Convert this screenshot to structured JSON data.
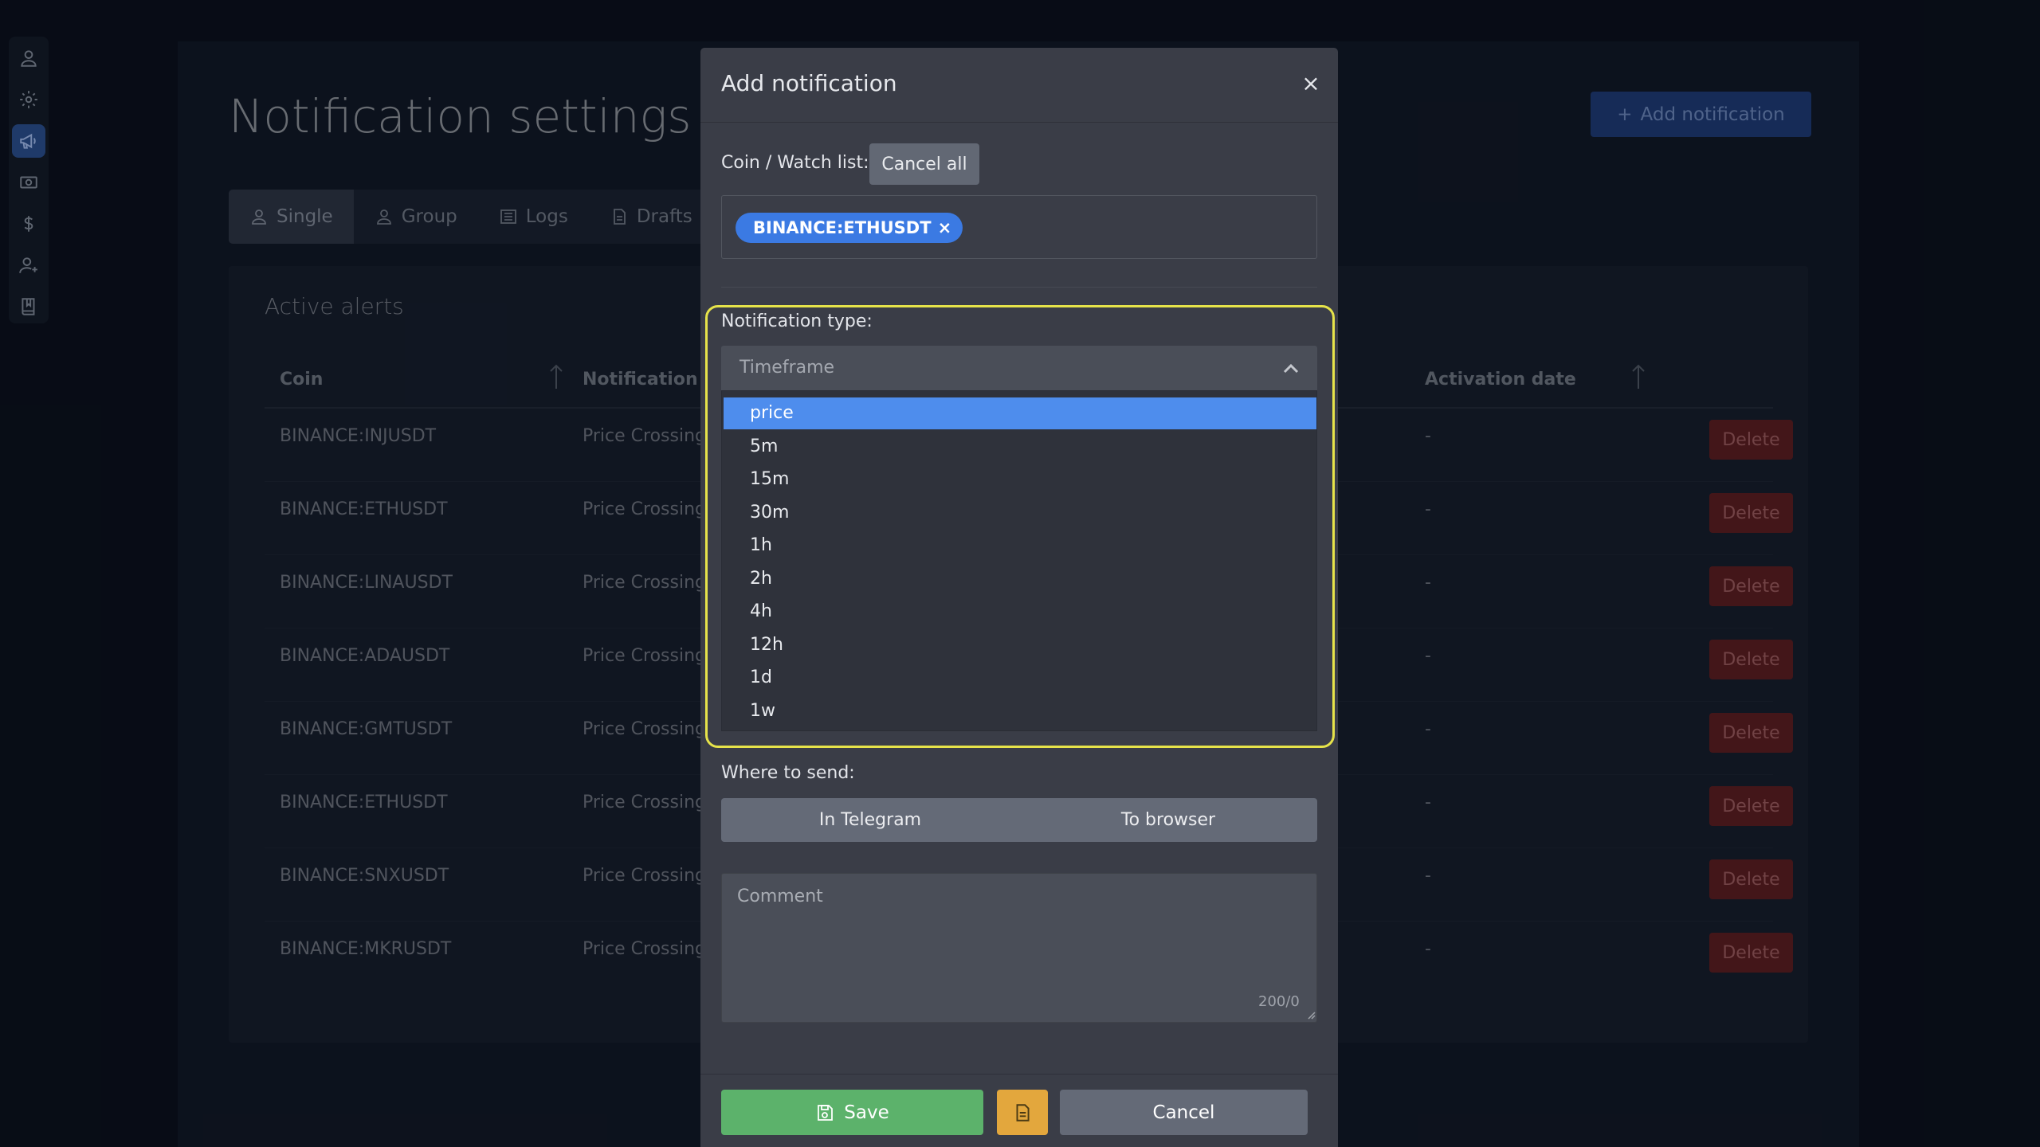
{
  "sidebar": {
    "items": [
      {
        "name": "profile",
        "icon": "user-icon"
      },
      {
        "name": "settings",
        "icon": "gear-icon"
      },
      {
        "name": "notifications",
        "icon": "megaphone-icon",
        "active": true
      },
      {
        "name": "billing",
        "icon": "money-icon"
      },
      {
        "name": "pricing",
        "icon": "dollar-icon"
      },
      {
        "name": "referral",
        "icon": "user-plus-icon"
      },
      {
        "name": "docs",
        "icon": "book-icon"
      }
    ]
  },
  "page": {
    "title": "Notification settings",
    "add_button": "Add notification",
    "tabs": [
      {
        "label": "Single",
        "icon": "user-icon",
        "active": true
      },
      {
        "label": "Group",
        "icon": "users-icon"
      },
      {
        "label": "Logs",
        "icon": "list-icon"
      },
      {
        "label": "Drafts",
        "icon": "document-icon"
      }
    ],
    "alerts": {
      "title": "Active alerts",
      "columns": {
        "coin": "Coin",
        "notification_type": "Notification ty",
        "activation_date": "Activation date"
      },
      "delete_label": "Delete",
      "rows": [
        {
          "coin": "BINANCE:INJUSDT",
          "type": "Price Crossing",
          "date": "-"
        },
        {
          "coin": "BINANCE:ETHUSDT",
          "type": "Price Crossing",
          "date": "-"
        },
        {
          "coin": "BINANCE:LINAUSDT",
          "type": "Price Crossing",
          "date": "-"
        },
        {
          "coin": "BINANCE:ADAUSDT",
          "type": "Price Crossing",
          "date": "-"
        },
        {
          "coin": "BINANCE:GMTUSDT",
          "type": "Price Crossing",
          "date": "-"
        },
        {
          "coin": "BINANCE:ETHUSDT",
          "type": "Price Crossing",
          "date": "-"
        },
        {
          "coin": "BINANCE:SNXUSDT",
          "type": "Price Crossing",
          "date": "-"
        },
        {
          "coin": "BINANCE:MKRUSDT",
          "type": "Price Crossing",
          "date": "-"
        }
      ]
    }
  },
  "modal": {
    "title": "Add notification",
    "close": "×",
    "coin_label": "Coin / Watch list:",
    "cancel_all": "Cancel all",
    "chip": "BINANCE:ETHUSDT",
    "chip_remove": "×",
    "notification_type_label": "Notification type:",
    "select_value": "Timeframe",
    "options": [
      "price",
      "5m",
      "15m",
      "30m",
      "1h",
      "2h",
      "4h",
      "12h",
      "1d",
      "1w"
    ],
    "selected_option": "price",
    "where_to_send_label": "Where to send:",
    "send_options": [
      "In Telegram",
      "To browser"
    ],
    "comment_placeholder": "Comment",
    "counter": "200/0",
    "save": "Save",
    "cancel": "Cancel"
  },
  "colors": {
    "accent": "#3b7ae3",
    "selected_option": "#4e8ded",
    "save": "#5cb26b",
    "draft": "#e3a73d",
    "highlight": "#e6e34a",
    "delete": "#5a1e22"
  }
}
